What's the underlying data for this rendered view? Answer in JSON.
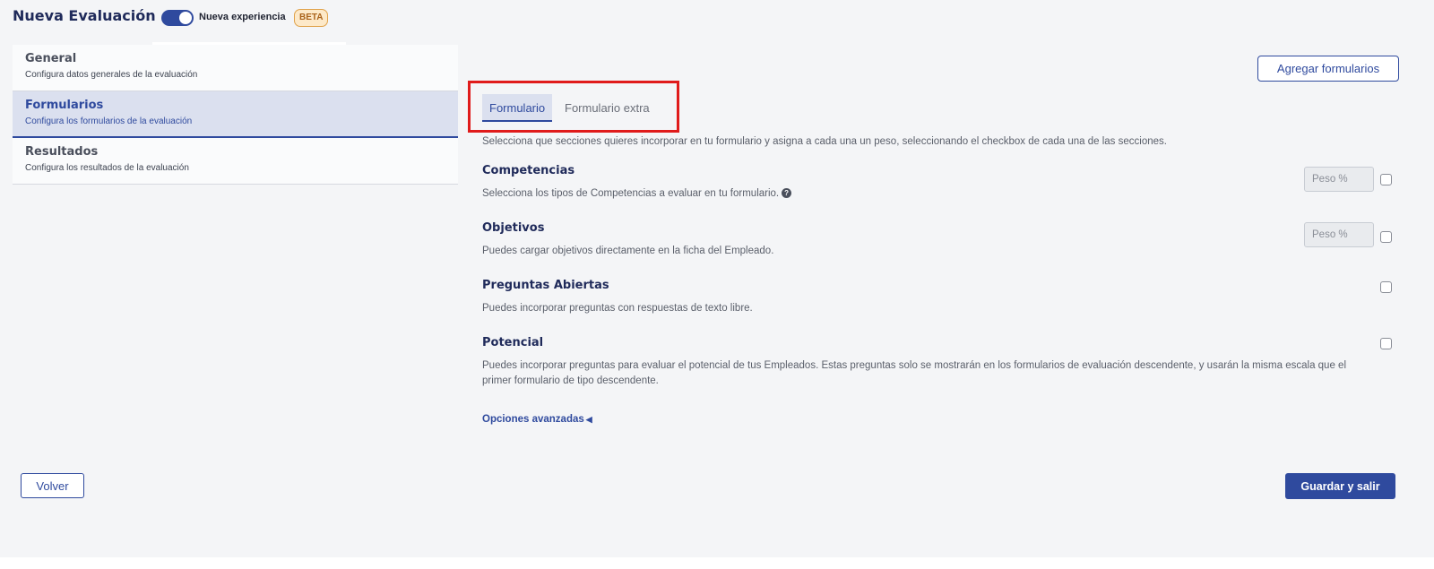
{
  "header": {
    "title": "Nueva Evaluación",
    "toggle_label": "Nueva experiencia",
    "toggle_on": true,
    "badge": "BETA"
  },
  "steps": [
    {
      "title": "General",
      "desc": "Configura datos generales de la evaluación",
      "active": false
    },
    {
      "title": "Formularios",
      "desc": "Configura los formularios de la evaluación",
      "active": true
    },
    {
      "title": "Resultados",
      "desc": "Configura los resultados de la evaluación",
      "active": false
    }
  ],
  "main": {
    "add_forms_label": "Agregar formularios",
    "tabs": [
      {
        "label": "Formulario",
        "active": true
      },
      {
        "label": "Formulario extra",
        "active": false
      }
    ],
    "intro": "Selecciona que secciones quieres incorporar en tu formulario y asigna a cada una un peso, seleccionando el checkbox de cada una de las secciones.",
    "sections": [
      {
        "title": "Competencias",
        "desc": "Selecciona los tipos de Competencias a evaluar en tu formulario.",
        "weight_placeholder": "Peso %",
        "checked": false
      },
      {
        "title": "Objetivos",
        "desc": "Puedes cargar objetivos directamente en la ficha del Empleado.",
        "weight_placeholder": "Peso %",
        "checked": false
      },
      {
        "title": "Preguntas Abiertas",
        "desc": "Puedes incorporar preguntas con respuestas de texto libre.",
        "checked": false
      },
      {
        "title": "Potencial",
        "desc": "Puedes incorporar preguntas para evaluar el potencial de tus Empleados. Estas preguntas solo se mostrarán en los formularios de evaluación descendente, y usarán la misma escala que el primer formulario de tipo descendente.",
        "checked": false
      }
    ],
    "advanced_label": "Opciones avanzadas"
  },
  "footer": {
    "back_label": "Volver",
    "save_label": "Guardar y salir"
  },
  "colors": {
    "accent": "#2f4a9e",
    "highlight": "#e01b1b",
    "badge_bg": "#fde9c9"
  }
}
